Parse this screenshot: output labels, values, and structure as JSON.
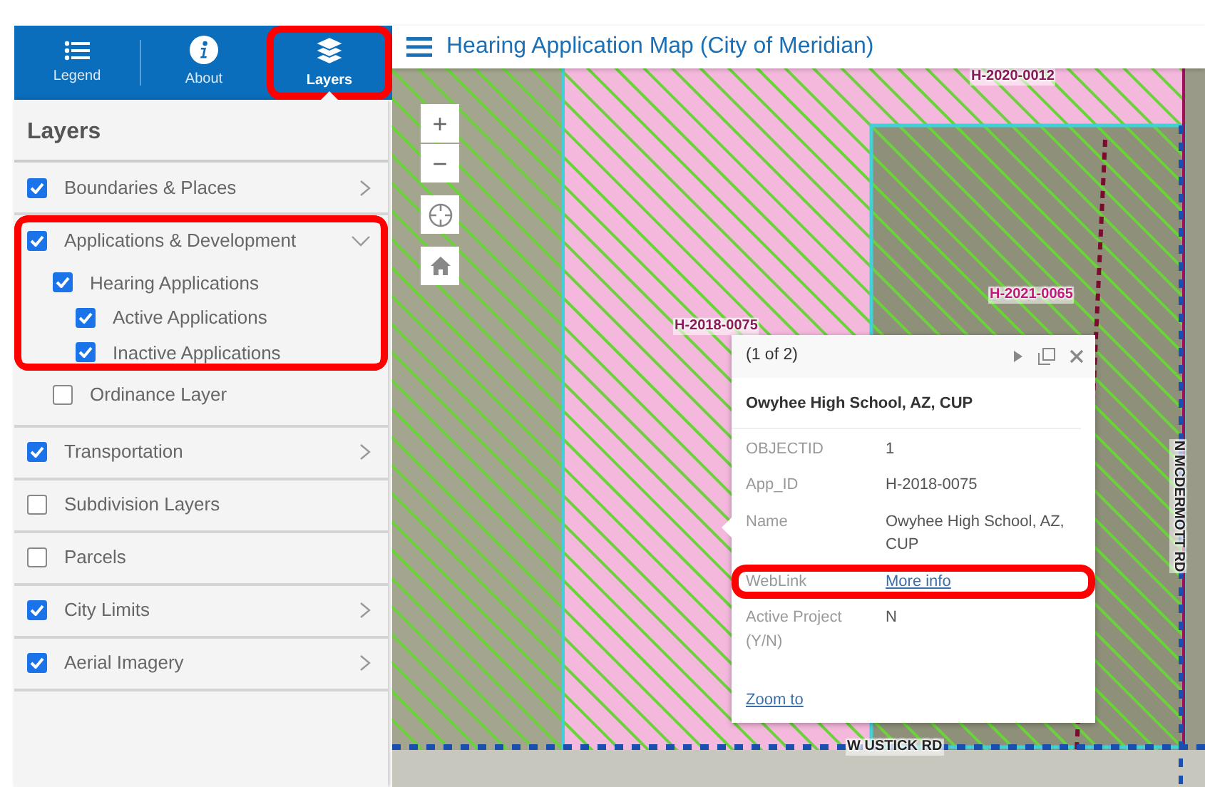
{
  "sidebar": {
    "tabs": [
      {
        "label": "Legend",
        "selected": false,
        "highlighted": false
      },
      {
        "label": "About",
        "selected": false,
        "highlighted": false
      },
      {
        "label": "Layers",
        "selected": true,
        "highlighted": true
      }
    ],
    "panel_title": "Layers",
    "layers": [
      {
        "label": "Boundaries & Places",
        "checked": true,
        "expanded": false,
        "highlighted": false
      },
      {
        "label": "Applications & Development",
        "checked": true,
        "expanded": true,
        "highlighted": true,
        "children": [
          {
            "label": "Hearing Applications",
            "checked": true,
            "highlighted": true,
            "children": [
              {
                "label": "Active Applications",
                "checked": true,
                "highlighted": true
              },
              {
                "label": "Inactive Applications",
                "checked": true,
                "highlighted": true
              }
            ]
          },
          {
            "label": "Ordinance Layer",
            "checked": false,
            "highlighted": false
          }
        ]
      },
      {
        "label": "Transportation",
        "checked": true,
        "expanded": false,
        "highlighted": false
      },
      {
        "label": "Subdivision Layers",
        "checked": false,
        "highlighted": false
      },
      {
        "label": "Parcels",
        "checked": false,
        "highlighted": false
      },
      {
        "label": "City Limits",
        "checked": true,
        "expanded": false,
        "highlighted": false
      },
      {
        "label": "Aerial Imagery",
        "checked": true,
        "expanded": false,
        "highlighted": false
      }
    ]
  },
  "header": {
    "title": "Hearing Application Map (City of Meridian)"
  },
  "map": {
    "controls": [
      {
        "kind": "zoom-in",
        "label": "+"
      },
      {
        "kind": "zoom-out",
        "label": "−"
      },
      {
        "kind": "locate"
      },
      {
        "kind": "home"
      }
    ],
    "labels": [
      {
        "text": "H-2020-0012",
        "kind": "parcel",
        "color": "#8b1a5a"
      },
      {
        "text": "H-2018-0075",
        "kind": "parcel",
        "color": "#8b1a5a"
      },
      {
        "text": "H-2021-0065",
        "kind": "parcel",
        "color": "#c2187a"
      },
      {
        "text": "N MCDERMOTT RD",
        "kind": "road-vertical",
        "color": "#222222"
      },
      {
        "text": "W USTICK RD",
        "kind": "road",
        "color": "#222222"
      }
    ]
  },
  "popup": {
    "pager": "(1 of 2)",
    "title": "Owyhee High School, AZ, CUP",
    "fields": [
      {
        "name": "OBJECTID",
        "value": "1",
        "kind": "text",
        "highlighted": false
      },
      {
        "name": "App_ID",
        "value": "H-2018-0075",
        "kind": "text",
        "highlighted": false
      },
      {
        "name": "Name",
        "value": "Owyhee High School, AZ, CUP",
        "kind": "text",
        "highlighted": false
      },
      {
        "name": "WebLink",
        "value": "More info",
        "kind": "link",
        "highlighted": true
      },
      {
        "name": "Active Project (Y/N)",
        "value": "N",
        "kind": "text",
        "highlighted": false
      }
    ],
    "action": "Zoom to"
  }
}
